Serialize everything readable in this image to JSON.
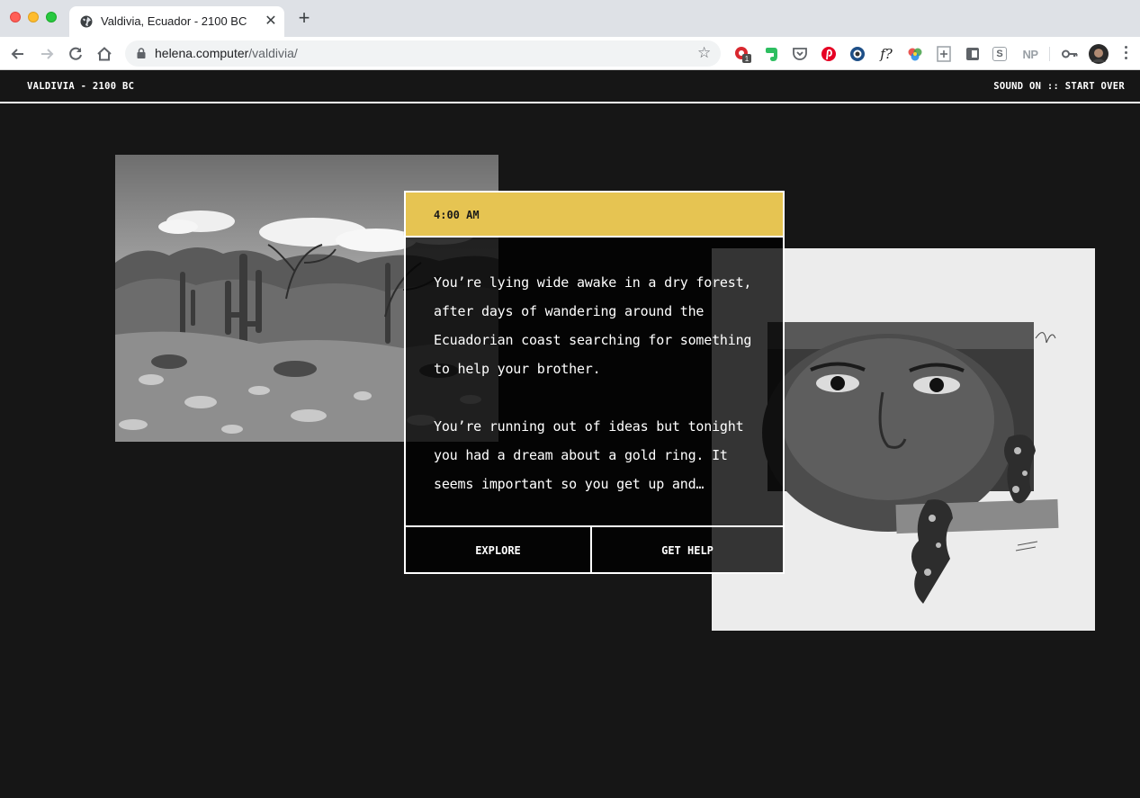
{
  "browser": {
    "tab_title": "Valdivia, Ecuador - 2100 BC",
    "url_host": "helena.computer",
    "url_path": "/valdivia/",
    "extensions": [
      "ghostery-icon",
      "evernote-icon",
      "pocket-icon",
      "pinterest-icon",
      "camera-icon",
      "fx-icon",
      "color-wheel-icon",
      "plus-box-icon",
      "clipboard-icon",
      "s-icon",
      "np-icon",
      "key-icon",
      "profile-avatar"
    ],
    "ext_badge": "1",
    "ext_fx_label": "f?",
    "ext_s_label": "S",
    "ext_np_label": "NP"
  },
  "site": {
    "title": "VALDIVIA - 2100 BC",
    "sound": "SOUND ON",
    "separator": " :: ",
    "restart": "START OVER"
  },
  "card": {
    "time": "4:00 AM",
    "paragraphs": [
      "You’re lying wide awake in a dry forest, after days of wandering around the Ecuadorian coast searching for something to help your brother.",
      "You’re running out of ideas but tonight you had a dream about a gold ring. It seems important so you get up and…"
    ],
    "actions": {
      "explore": "EXPLORE",
      "help": "GET HELP"
    }
  },
  "colors": {
    "page_bg": "#161616",
    "time_bar": "#e6c452"
  }
}
